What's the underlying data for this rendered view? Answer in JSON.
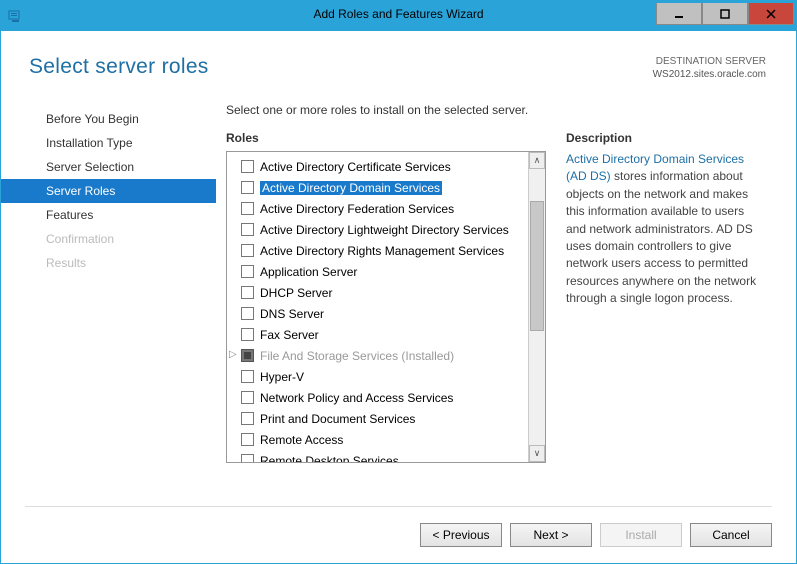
{
  "window": {
    "title": "Add Roles and Features Wizard"
  },
  "header": {
    "title": "Select server roles",
    "destination_label": "DESTINATION SERVER",
    "destination_value": "WS2012.sites.oracle.com"
  },
  "nav": {
    "items": [
      {
        "label": "Before You Begin",
        "state": "normal"
      },
      {
        "label": "Installation Type",
        "state": "normal"
      },
      {
        "label": "Server Selection",
        "state": "normal"
      },
      {
        "label": "Server Roles",
        "state": "selected"
      },
      {
        "label": "Features",
        "state": "normal"
      },
      {
        "label": "Confirmation",
        "state": "disabled"
      },
      {
        "label": "Results",
        "state": "disabled"
      }
    ]
  },
  "main": {
    "instruction": "Select one or more roles to install on the selected server.",
    "roles_heading": "Roles",
    "description_heading": "Description",
    "roles": [
      {
        "label": "Active Directory Certificate Services"
      },
      {
        "label": "Active Directory Domain Services",
        "highlight": true
      },
      {
        "label": "Active Directory Federation Services"
      },
      {
        "label": "Active Directory Lightweight Directory Services"
      },
      {
        "label": "Active Directory Rights Management Services"
      },
      {
        "label": "Application Server"
      },
      {
        "label": "DHCP Server"
      },
      {
        "label": "DNS Server"
      },
      {
        "label": "Fax Server"
      },
      {
        "label": "File And Storage Services (Installed)",
        "installed": true,
        "expandable": true
      },
      {
        "label": "Hyper-V"
      },
      {
        "label": "Network Policy and Access Services"
      },
      {
        "label": "Print and Document Services"
      },
      {
        "label": "Remote Access"
      },
      {
        "label": "Remote Desktop Services"
      }
    ],
    "description_link": "Active Directory Domain Services (AD DS)",
    "description_rest": " stores information about objects on the network and makes this information available to users and network administrators. AD DS uses domain controllers to give network users access to permitted resources anywhere on the network through a single logon process."
  },
  "footer": {
    "previous": "< Previous",
    "next": "Next >",
    "install": "Install",
    "cancel": "Cancel"
  }
}
